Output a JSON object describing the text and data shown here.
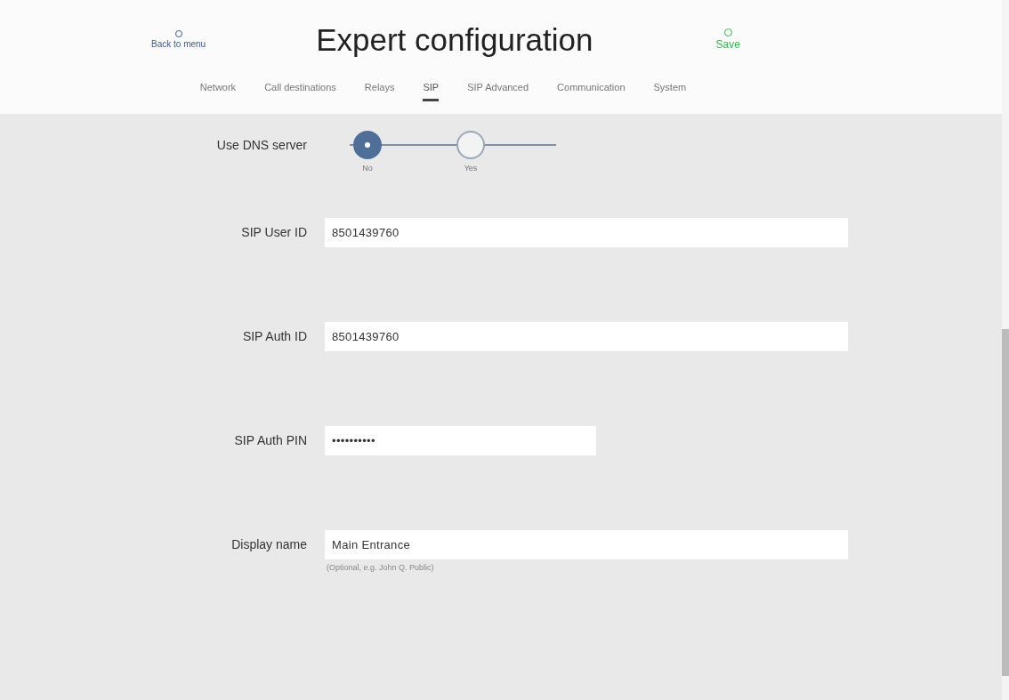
{
  "header": {
    "back": "Back to menu",
    "title": "Expert configuration",
    "save": "Save"
  },
  "tabs": [
    {
      "label": "Network",
      "selected": false
    },
    {
      "label": "Call destinations",
      "selected": false
    },
    {
      "label": "Relays",
      "selected": false
    },
    {
      "label": "SIP",
      "selected": true
    },
    {
      "label": "SIP Advanced",
      "selected": false
    },
    {
      "label": "Communication",
      "selected": false
    },
    {
      "label": "System",
      "selected": false
    }
  ],
  "rows": [
    {
      "kind": "choice",
      "label": "Use DNS server",
      "options": [
        {
          "label": "No",
          "selected": true
        },
        {
          "label": "Yes",
          "selected": false
        }
      ]
    },
    {
      "kind": "text",
      "label": "SIP User ID",
      "value": "8501439760"
    },
    {
      "kind": "text",
      "label": "SIP Auth ID",
      "value": "8501439760"
    },
    {
      "kind": "pin",
      "label": "SIP Auth PIN",
      "value": "••••••••••"
    },
    {
      "kind": "text",
      "label": "Display name",
      "value": "Main Entrance",
      "hint": "(Optional, e.g. John Q. Public)"
    }
  ]
}
